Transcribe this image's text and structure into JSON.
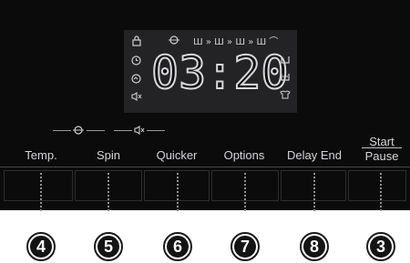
{
  "display": {
    "time": "03:20",
    "left_icons": [
      "lock-icon",
      "clock-icon",
      "eco-icon",
      "mute-icon"
    ],
    "right_icons": [
      "rinse-icon",
      "detergent-icon",
      "shirt-icon"
    ],
    "top_icons": [
      "steam-icon"
    ]
  },
  "buttons": [
    {
      "label": "Temp.",
      "number": "4"
    },
    {
      "label": "Spin",
      "number": "5"
    },
    {
      "label": "Quicker",
      "number": "6"
    },
    {
      "label": "Options",
      "number": "7"
    },
    {
      "label": "Delay End",
      "number": "8"
    }
  ],
  "start": {
    "top": "Start",
    "bottom": "Pause",
    "number": "3"
  },
  "colors": {
    "panel": "#0b0b0c",
    "display": "#232326",
    "text": "#d5d5d8"
  }
}
